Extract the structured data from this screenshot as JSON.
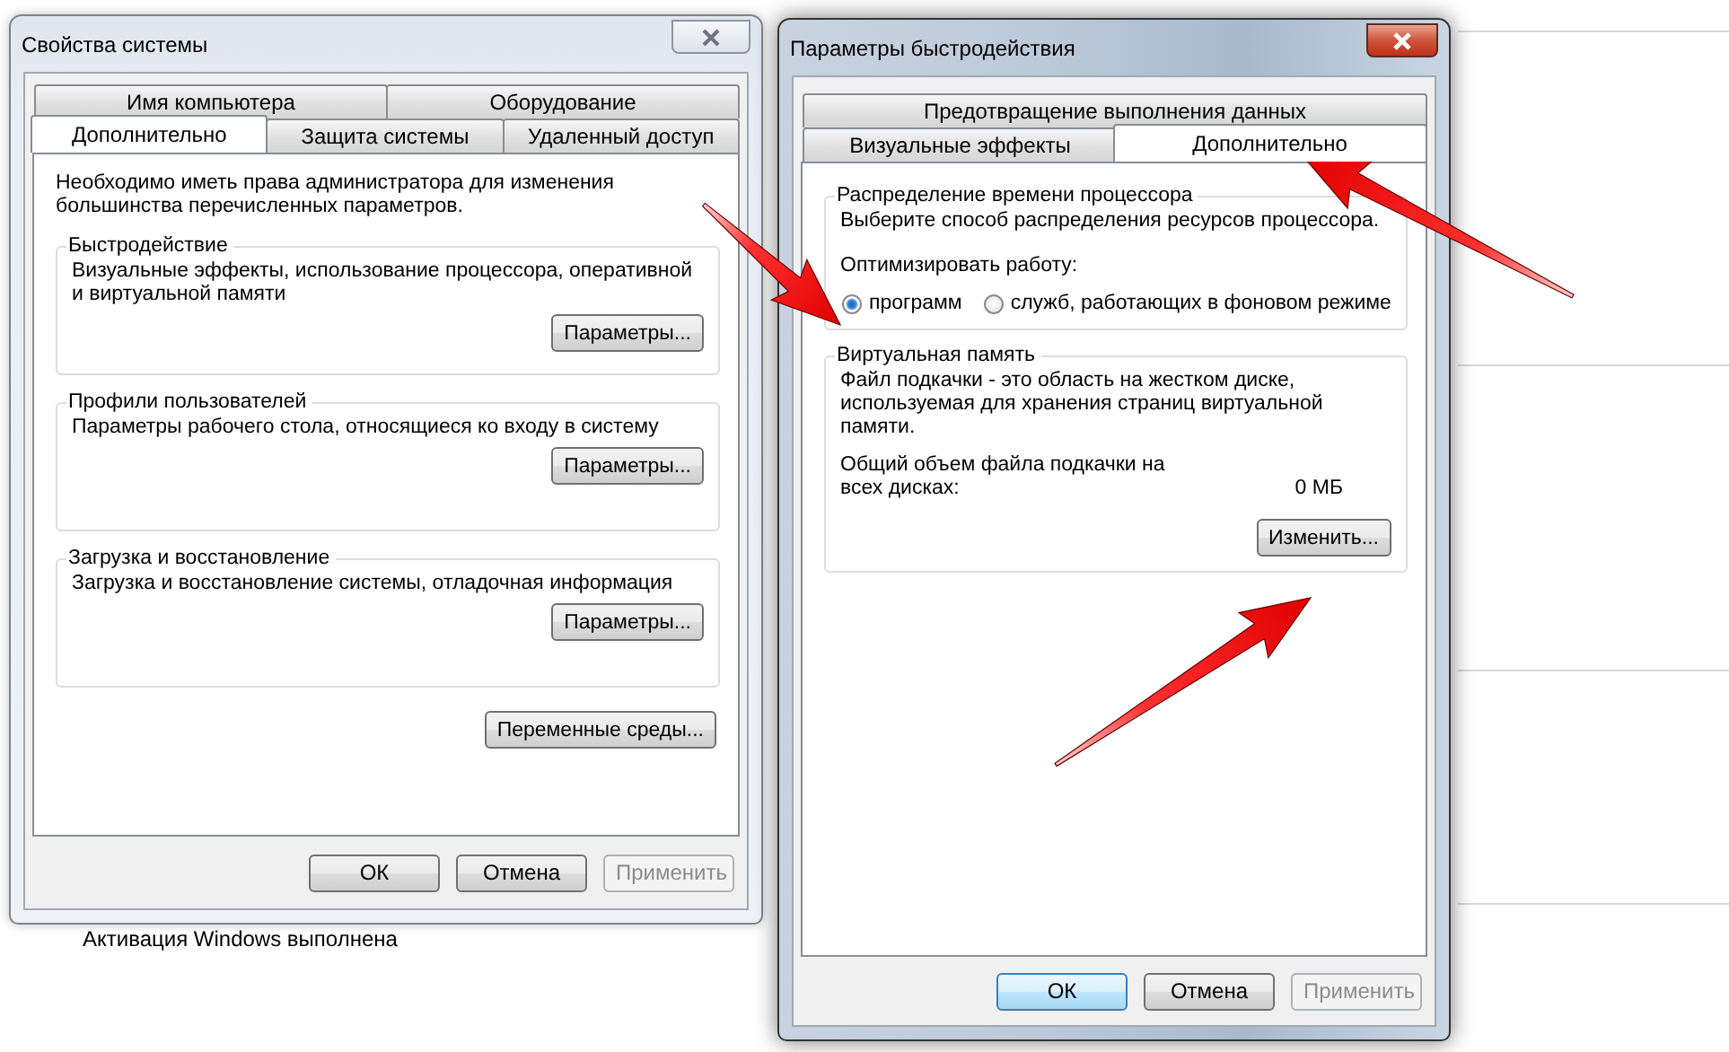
{
  "desktop": {
    "status_text": "Активация Windows выполнена"
  },
  "windows": [
    {
      "title": "Свойства системы",
      "active": false,
      "tab_rows": [
        [
          {
            "label": "Имя компьютера",
            "selected": false
          },
          {
            "label": "Оборудование",
            "selected": false
          }
        ],
        [
          {
            "label": "Дополнительно",
            "selected": true
          },
          {
            "label": "Защита системы",
            "selected": false
          },
          {
            "label": "Удаленный доступ",
            "selected": false
          }
        ]
      ],
      "body": [
        {
          "kind": "note",
          "text": "Необходимо иметь права администратора для изменения большинства перечисленных параметров."
        },
        {
          "kind": "group",
          "title": "Быстродействие",
          "items": [
            {
              "kind": "text",
              "text": "Визуальные эффекты, использование процессора, оперативной и виртуальной памяти"
            },
            {
              "kind": "button",
              "label": "Параметры..."
            }
          ]
        },
        {
          "kind": "group",
          "title": "Профили пользователей",
          "items": [
            {
              "kind": "text",
              "text": "Параметры рабочего стола, относящиеся ко входу в систему"
            },
            {
              "kind": "button",
              "label": "Параметры..."
            }
          ]
        },
        {
          "kind": "group",
          "title": "Загрузка и восстановление",
          "items": [
            {
              "kind": "text",
              "text": "Загрузка и восстановление системы, отладочная информация"
            },
            {
              "kind": "button",
              "label": "Параметры..."
            }
          ]
        },
        {
          "kind": "button",
          "label": "Переменные среды..."
        }
      ],
      "footer": [
        {
          "label": "ОК",
          "default": false,
          "disabled": false
        },
        {
          "label": "Отмена",
          "default": false,
          "disabled": false
        },
        {
          "label": "Применить",
          "default": false,
          "disabled": true
        }
      ]
    },
    {
      "title": "Параметры быстродействия",
      "active": true,
      "tab_rows": [
        [
          {
            "label": "Предотвращение выполнения данных",
            "selected": false
          }
        ],
        [
          {
            "label": "Визуальные эффекты",
            "selected": false
          },
          {
            "label": "Дополнительно",
            "selected": true
          }
        ]
      ],
      "body": [
        {
          "kind": "group",
          "title": "Распределение времени процессора",
          "items": [
            {
              "kind": "text",
              "text": "Выберите способ распределения ресурсов процессора."
            },
            {
              "kind": "radio_group",
              "label": "Оптимизировать работу:",
              "options": [
                {
                  "label": "программ",
                  "selected": true
                },
                {
                  "label": "служб, работающих в фоновом режиме",
                  "selected": false
                }
              ]
            }
          ]
        },
        {
          "kind": "group",
          "title": "Виртуальная память",
          "items": [
            {
              "kind": "text",
              "text": "Файл подкачки - это область на жестком диске, используемая для хранения страниц виртуальной памяти."
            },
            {
              "kind": "value_row",
              "label": "Общий объем файла подкачки на всех дисках:",
              "value": "0 МБ"
            },
            {
              "kind": "button",
              "label": "Изменить..."
            }
          ]
        }
      ],
      "footer": [
        {
          "label": "ОК",
          "default": true,
          "disabled": false
        },
        {
          "label": "Отмена",
          "default": false,
          "disabled": false
        },
        {
          "label": "Применить",
          "default": false,
          "disabled": true
        }
      ]
    }
  ]
}
